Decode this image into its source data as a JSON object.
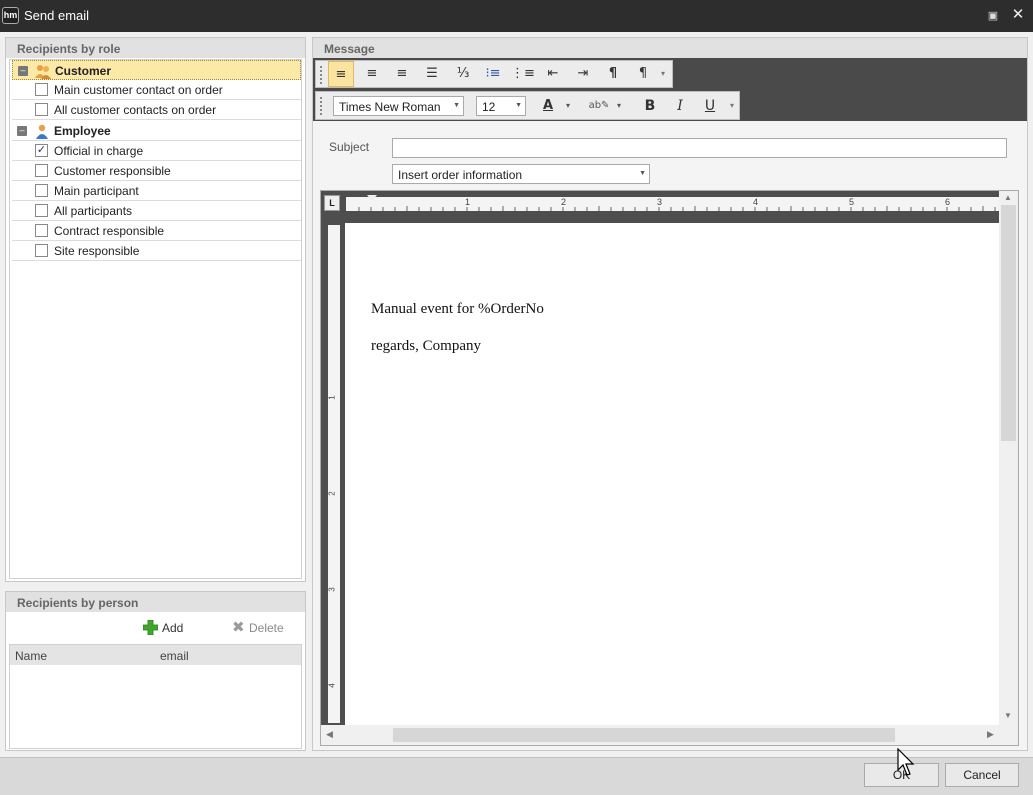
{
  "window": {
    "title": "Send email"
  },
  "recipients_by_role": {
    "header": "Recipients by role",
    "groups": [
      {
        "label": "Customer",
        "items": [
          {
            "label": "Main customer contact on order",
            "checked": false
          },
          {
            "label": "All customer contacts on order",
            "checked": false
          }
        ]
      },
      {
        "label": "Employee",
        "items": [
          {
            "label": "Official in charge",
            "checked": true
          },
          {
            "label": "Customer responsible",
            "checked": false
          },
          {
            "label": "Main participant",
            "checked": false
          },
          {
            "label": "All participants",
            "checked": false
          },
          {
            "label": "Contract responsible",
            "checked": false
          },
          {
            "label": "Site responsible",
            "checked": false
          }
        ]
      }
    ]
  },
  "recipients_by_person": {
    "header": "Recipients by person",
    "add_label": "Add",
    "delete_label": "Delete",
    "columns": [
      "Name",
      "email"
    ]
  },
  "message": {
    "header": "Message",
    "font_name": "Times New Roman",
    "font_size": "12",
    "bold_label": "B",
    "italic_label": "I",
    "underline_label": "U",
    "subject_label": "Subject",
    "subject_value": "",
    "insert_order_info": "Insert order information",
    "ruler_h_numbers": [
      "1",
      "2",
      "3",
      "4",
      "5",
      "6"
    ],
    "ruler_v_numbers": [
      "1",
      "2",
      "3",
      "4"
    ],
    "body_lines": [
      "Manual event for %OrderNo",
      "regards, Company"
    ]
  },
  "footer": {
    "ok_label": "OK",
    "cancel_label": "Cancel"
  },
  "colors": {
    "accent_selection": "#fbe9a8",
    "titlebar": "#2d2d2d",
    "dark_toolbar": "#4a4a4a"
  }
}
